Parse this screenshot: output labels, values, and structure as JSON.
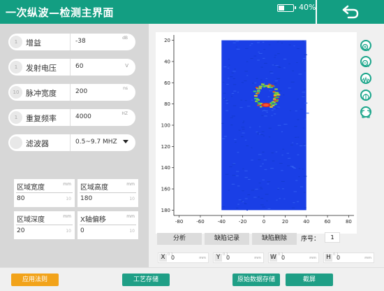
{
  "header": {
    "title": "一次纵波—检测主界面",
    "battery_percent_text": "40%",
    "battery_level": 0.4,
    "back_icon": "back-arrow-icon"
  },
  "params": [
    {
      "dot": "1",
      "label": "增益",
      "value": "-38",
      "unit": "dB"
    },
    {
      "dot": "1",
      "label": "发射电压",
      "value": "60",
      "unit": "V"
    },
    {
      "dot": "10",
      "label": "脉冲宽度",
      "value": "200",
      "unit": "ns"
    },
    {
      "dot": "1",
      "label": "重复频率",
      "value": "4000",
      "unit": "HZ"
    },
    {
      "dot": "",
      "label": "滤波器",
      "value": "0.5~9.7 MHZ",
      "unit": ""
    }
  ],
  "regions": [
    {
      "label": "区域宽度",
      "unit": "mm",
      "value": "80",
      "step": "10"
    },
    {
      "label": "区域高度",
      "unit": "mm",
      "value": "180",
      "step": "10"
    },
    {
      "label": "区域深度",
      "unit": "mm",
      "value": "20",
      "step": "10"
    },
    {
      "label": "X轴偏移",
      "unit": "mm",
      "value": "0",
      "step": "10"
    }
  ],
  "chart_data": {
    "type": "heatmap",
    "x_ticks": [
      "-80",
      "-60",
      "-40",
      "-20",
      "0",
      "20",
      "40",
      "60",
      "80"
    ],
    "y_ticks": [
      "20",
      "40",
      "60",
      "80",
      "100",
      "120",
      "140",
      "160",
      "180"
    ],
    "xlim": [
      -85,
      85
    ],
    "ylim": [
      15,
      185
    ],
    "image_extent": {
      "x": [
        -40,
        40
      ],
      "y": [
        20,
        180
      ]
    },
    "background_color": "#1a3fe6",
    "defect_ring": {
      "center_x": 2,
      "center_y": 72,
      "radius_x": 10,
      "radius_y": 10
    },
    "defect_hotspot": {
      "x": 2,
      "y": 81
    }
  },
  "side_icons": [
    "zoom-in-icon",
    "zoom-out-icon",
    "waveform-icon",
    "rotate-icon",
    "expand-icon"
  ],
  "actions": {
    "analyze": "分析",
    "defect_record": "缺陷记录",
    "defect_delete": "缺陷删除",
    "seq_label": "序号：",
    "seq_value": "1"
  },
  "coords": [
    {
      "label": "X",
      "value": "0",
      "unit": "mm",
      "step": "0.1"
    },
    {
      "label": "Y",
      "value": "0",
      "unit": "mm",
      "step": "0.1"
    },
    {
      "label": "W",
      "value": "0",
      "unit": "mm",
      "step": "0.1"
    },
    {
      "label": "H",
      "value": "0",
      "unit": "mm",
      "step": "0.1"
    }
  ],
  "footer": {
    "apply_rule": "应用法则",
    "process_save": "工艺存储",
    "raw_data_save": "原始数据存储",
    "screenshot": "截屏"
  },
  "colors": {
    "accent": "#139e82",
    "orange": "#f2a31a",
    "green_btn": "#1f9f86"
  }
}
